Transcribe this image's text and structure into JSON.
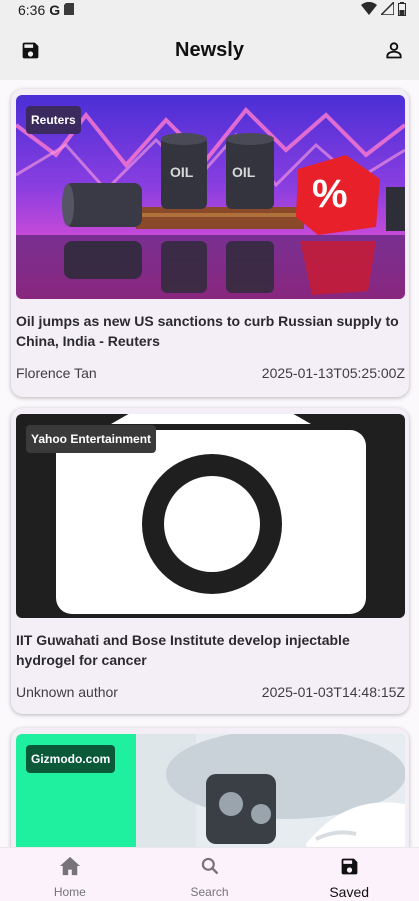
{
  "status_bar": {
    "time": "6:36",
    "icons": [
      "google-icon",
      "sd-card-icon",
      "wifi-icon",
      "signal-icon",
      "battery-icon"
    ]
  },
  "app_bar": {
    "title": "Newsly",
    "left_icon": "save-icon",
    "right_icon": "person-icon"
  },
  "articles": [
    {
      "source": "Reuters",
      "title": "Oil jumps as new US sanctions to curb Russian supply to China, India - Reuters",
      "author": "Florence Tan",
      "date": "2025-01-13T05:25:00Z",
      "badge_color": "#3b2a5e"
    },
    {
      "source": "Yahoo Entertainment",
      "title": "IIT Guwahati and Bose Institute develop injectable hydrogel for cancer",
      "author": "Unknown author",
      "date": "2025-01-03T14:48:15Z",
      "badge_color": "#3a3a3a"
    },
    {
      "source": "Gizmodo.com",
      "title": "",
      "author": "",
      "date": "",
      "badge_color": "#0a5a3a"
    }
  ],
  "bottom_nav": {
    "items": [
      {
        "label": "Home",
        "icon": "home-icon"
      },
      {
        "label": "Search",
        "icon": "search-icon"
      },
      {
        "label": "Saved",
        "icon": "save-icon"
      }
    ],
    "active": "Saved"
  },
  "colors": {
    "accent": "#111111",
    "background": "#fbf9fc",
    "card": "#f4eff6",
    "nav_background": "#fbf2fb"
  }
}
